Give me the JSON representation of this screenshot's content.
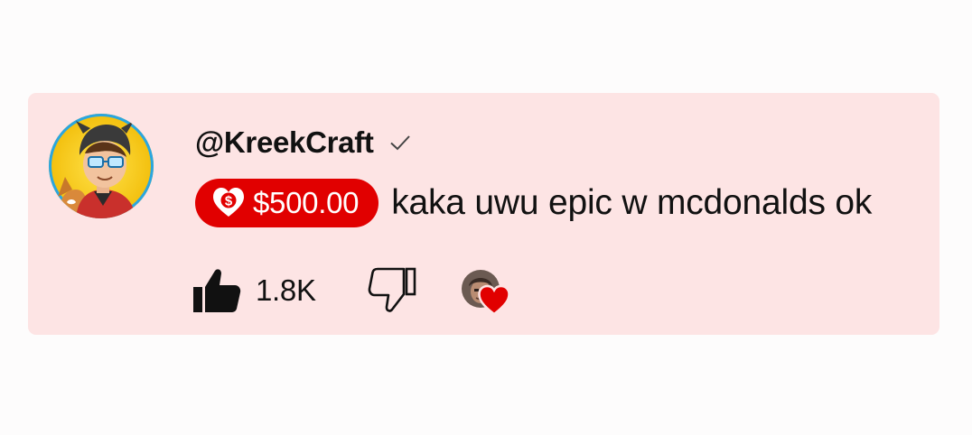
{
  "comment": {
    "author": "@KreekCraft",
    "verified": true,
    "super_thanks_amount": "$500.00",
    "text": "kaka uwu epic w mcdonalds ok",
    "like_count": "1.8K",
    "creator_hearted": true
  },
  "icons": {
    "avatar": "avatar-image",
    "verified": "checkmark-icon",
    "badge": "heart-dollar-icon",
    "like": "thumbs-up-icon",
    "dislike": "thumbs-down-icon",
    "creator_heart": "heart-icon"
  },
  "colors": {
    "card_background": "#fde4e4",
    "badge_red": "#e10000",
    "heart_red": "#e10000",
    "text": "#111111"
  }
}
